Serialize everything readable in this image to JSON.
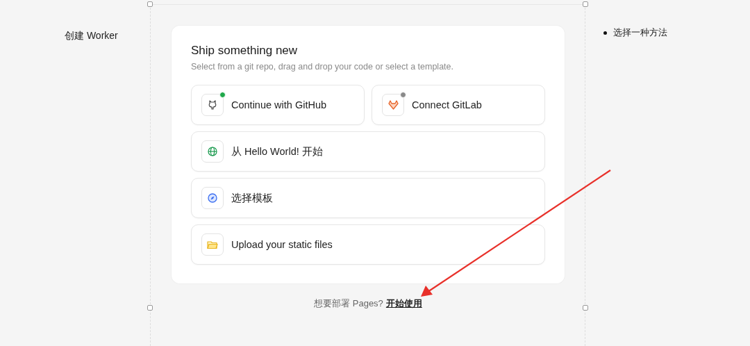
{
  "sidebar": {
    "title": "创建 Worker"
  },
  "card": {
    "title": "Ship something new",
    "subtitle": "Select from a git repo, drag and drop your code or select a template."
  },
  "options": [
    {
      "kind": "github",
      "label": "Continue with GitHub",
      "color": "#1fa84a"
    },
    {
      "kind": "gitlab",
      "label": "Connect GitLab",
      "color": "#8a8a8a"
    },
    {
      "kind": "hello",
      "label": "从 Hello World! 开始"
    },
    {
      "kind": "template",
      "label": "选择模板"
    },
    {
      "kind": "upload",
      "label": "Upload your static files"
    }
  ],
  "footer": {
    "prompt": "想要部署 Pages?",
    "link": "开始使用"
  },
  "steps": [
    {
      "label": "选择一种方法"
    }
  ]
}
